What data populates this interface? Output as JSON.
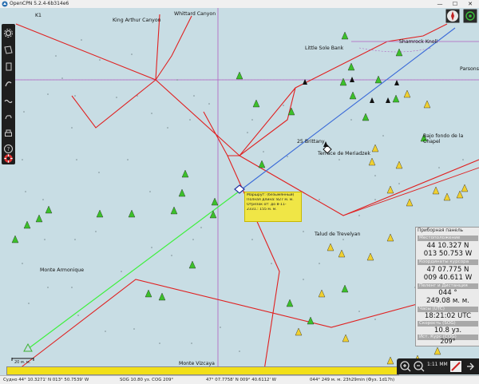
{
  "window": {
    "title": "OpenCPN 5.2.4-6b314e6",
    "minimize": "—",
    "maximize": "☐",
    "close": "✕"
  },
  "chart": {
    "place_names": {
      "k1": "K1",
      "king_arthur": "King Arthur Canyon",
      "whittard": "Whittard Canyon",
      "little_sole": "Little Sole Bank",
      "shamrock": "Shamrock Knoll",
      "parsons": "Parsons",
      "bajo": "Bajo fondo de la Chapel",
      "brittany": "25 Brittany",
      "meriadzek": "Terrace de Meriadzek",
      "trevelyan": "Talud de Trevelyan",
      "armonique": "Monte Armonique",
      "vizcaya": "Monte Vizcaya"
    },
    "route_popup": {
      "line1": "Маршрут: (безымянный)",
      "line2": "Полная длина: 827 м. м.",
      "line3": "Отрезок от: до 8-11-",
      "line4": "2331.: 155 м. м."
    },
    "scale_label": "20 м. м."
  },
  "dashboard": {
    "caption": "Приборная панель",
    "panels": [
      {
        "label": "Местоположение",
        "values": [
          "44 10.327 N",
          "013 50.753 W"
        ]
      },
      {
        "label": "Координаты курсора",
        "values": [
          "47 07.775 N",
          "009 40.611 W"
        ]
      },
      {
        "label": "Пеленг и Дистанция",
        "values": [
          "044 °",
          "249.08 м. м."
        ]
      },
      {
        "label": "Часы (UTC)",
        "values": [
          "18:21:02 UTC"
        ]
      },
      {
        "label": "Скорость (SOG)",
        "values": [
          "10.8 уз."
        ]
      },
      {
        "label": "Ист. Курс (COG)",
        "values": [
          "209°"
        ]
      }
    ]
  },
  "zoom": {
    "scale_text": "1:11 MM"
  },
  "status": {
    "ship": "Судно 44° 10.3271' N    013° 50.7539' W",
    "sog": "SOG 10.80 уз.   COG 209°",
    "cursor": "47° 07.7758' N    009° 40.6112' W",
    "bearing": "044°  249 м. м. 23h29min (Фуз. 1d17h)"
  },
  "progress": {
    "fraction": 0.995
  }
}
